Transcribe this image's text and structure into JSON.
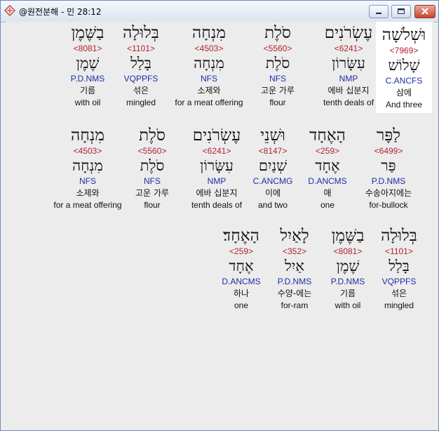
{
  "window": {
    "title": "@원전분해 - 민 28:12",
    "icon": "bible-app-icon",
    "controls": [
      "minimize-icon",
      "maximize-icon",
      "close-icon"
    ]
  },
  "rows": [
    [
      {
        "hebrew": "וּשְׁלֹשָׁה",
        "strong": "<7969>",
        "lemma": "שָׁלוֹשׁ",
        "morph": "C.ANCFS",
        "korean": "삼에",
        "english": "And three",
        "highlight": true
      },
      {
        "hebrew": "עֶשְׂרֹנִים",
        "strong": "<6241>",
        "lemma": "עִשָּׂרוֹן",
        "morph": "NMP",
        "korean": "에바 십분지",
        "english": "tenth deals of"
      },
      {
        "hebrew": "סֹלֶת",
        "strong": "<5560>",
        "lemma": "סֹלֶת",
        "morph": "NFS",
        "korean": "고운 가루",
        "english": "flour"
      },
      {
        "hebrew": "מִנְחָה",
        "strong": "<4503>",
        "lemma": "מִנְחָה",
        "morph": "NFS",
        "korean": "소제와",
        "english": "for a meat offering"
      },
      {
        "hebrew": "בְּלוּלָה",
        "strong": "<1101>",
        "lemma": "בָּלַל",
        "morph": "VQPPFS",
        "korean": "섞은",
        "english": "mingled"
      },
      {
        "hebrew": "בַשֶּׁמֶן",
        "strong": "<8081>",
        "lemma": "שֶׁמֶן",
        "morph": "P.D.NMS",
        "korean": "기름",
        "english": "with oil"
      }
    ],
    [
      {
        "hebrew": "לַפָּר",
        "strong": "<6499>",
        "lemma": "פַּר",
        "morph": "P.D.NMS",
        "korean": "수송아지에는",
        "english": "for-bullock"
      },
      {
        "hebrew": "הָאֶחָד",
        "strong": "<259>",
        "lemma": "אֶחָד",
        "morph": "D.ANCMS",
        "korean": "매",
        "english": "one"
      },
      {
        "hebrew": "וּשְׁנֵי",
        "strong": "<8147>",
        "lemma": "שְׁנַיִם",
        "morph": "C.ANCMG",
        "korean": "이에",
        "english": "and two"
      },
      {
        "hebrew": "עֶשְׂרֹנִים",
        "strong": "<6241>",
        "lemma": "עִשָּׂרוֹן",
        "morph": "NMP",
        "korean": "에바 십분지",
        "english": "tenth deals of"
      },
      {
        "hebrew": "סֹלֶת",
        "strong": "<5560>",
        "lemma": "סֹלֶת",
        "morph": "NFS",
        "korean": "고운 가루",
        "english": "flour"
      },
      {
        "hebrew": "מִנְחָה",
        "strong": "<4503>",
        "lemma": "מִנְחָה",
        "morph": "NFS",
        "korean": "소제와",
        "english": "for a meat offering"
      }
    ],
    [
      {
        "hebrew": "בְּלוּלָה",
        "strong": "<1101>",
        "lemma": "בָּלַל",
        "morph": "VQPPFS",
        "korean": "섞은",
        "english": "mingled"
      },
      {
        "hebrew": "בַשֶּׁמֶן",
        "strong": "<8081>",
        "lemma": "שֶׁמֶן",
        "morph": "P.D.NMS",
        "korean": "기름",
        "english": "with oil"
      },
      {
        "hebrew": "לָאַיִל",
        "strong": "<352>",
        "lemma": "אַיִל",
        "morph": "P.D.NMS",
        "korean": "수양-에는",
        "english": "for-ram"
      },
      {
        "hebrew": "הָאֶחָד׃",
        "strong": "<259>",
        "lemma": "אֶחָד",
        "morph": "D.ANCMS",
        "korean": "하나",
        "english": "one"
      }
    ]
  ]
}
